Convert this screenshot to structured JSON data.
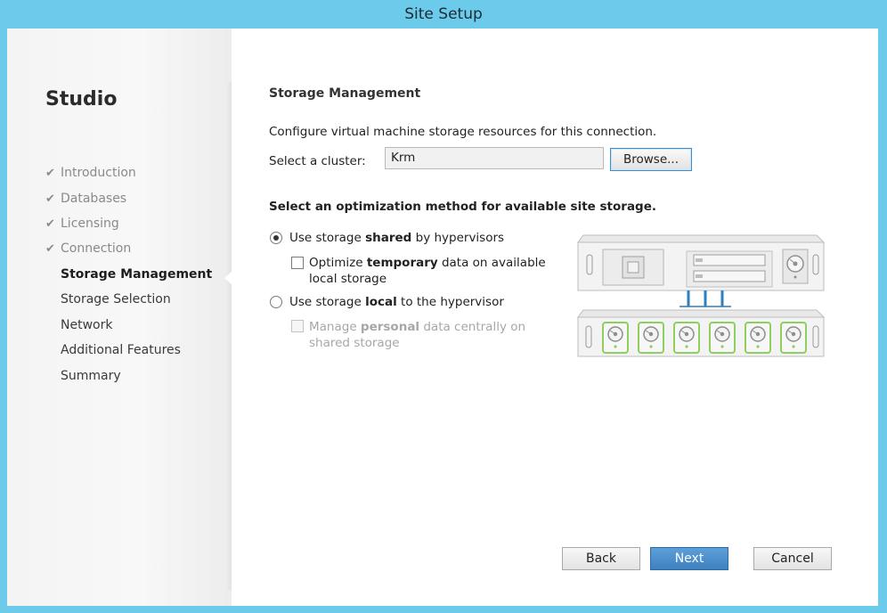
{
  "window": {
    "title": "Site Setup"
  },
  "sidebar": {
    "app_name": "Studio",
    "steps": [
      {
        "label": "Introduction",
        "status": "done"
      },
      {
        "label": "Databases",
        "status": "done"
      },
      {
        "label": "Licensing",
        "status": "done"
      },
      {
        "label": "Connection",
        "status": "done"
      },
      {
        "label": "Storage Management",
        "status": "current"
      },
      {
        "label": "Storage Selection",
        "status": "todo"
      },
      {
        "label": "Network",
        "status": "todo"
      },
      {
        "label": "Additional Features",
        "status": "todo"
      },
      {
        "label": "Summary",
        "status": "todo"
      }
    ],
    "check_icon": "✔"
  },
  "main": {
    "title": "Storage Management",
    "description": "Configure virtual machine storage resources for this connection.",
    "cluster": {
      "label": "Select a cluster:",
      "value": "Krm",
      "browse_label": "Browse..."
    },
    "optimization_heading": "Select an optimization method for available site storage.",
    "option_shared": {
      "pre": "Use storage ",
      "bold": "shared",
      "post": " by hypervisors",
      "selected": true
    },
    "optimize_temp": {
      "pre": "Optimize ",
      "bold": "temporary",
      "post": " data on available",
      "line2": "local storage",
      "checked": false
    },
    "option_local": {
      "pre": "Use storage ",
      "bold": "local",
      "post": " to the hypervisor",
      "selected": false
    },
    "manage_personal": {
      "pre": "Manage ",
      "bold": "personal",
      "post": " data centrally on",
      "line2": "shared storage",
      "checked": false,
      "disabled": true
    }
  },
  "footer": {
    "back": "Back",
    "next": "Next",
    "cancel": "Cancel"
  },
  "colors": {
    "accent": "#3f81c0",
    "titlebar": "#6ccbea",
    "disk_green": "#8fcf5f",
    "link_blue": "#2d7fc1"
  }
}
